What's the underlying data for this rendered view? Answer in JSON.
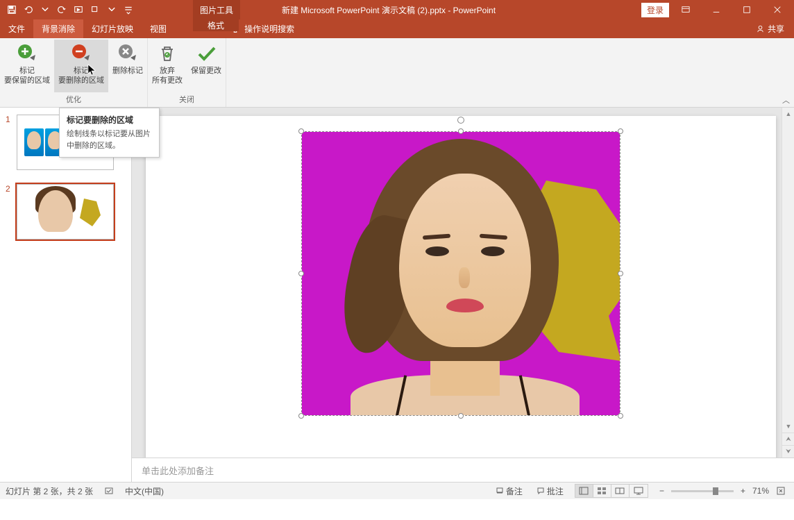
{
  "title": "新建 Microsoft PowerPoint 演示文稿 (2).pptx  -  PowerPoint",
  "tool_context": "图片工具",
  "login": "登录",
  "tabs": {
    "file": "文件",
    "bgremove": "背景消除",
    "slideshow": "幻灯片放映",
    "view": "视图",
    "format": "格式",
    "tell": "操作说明搜索",
    "share": "共享"
  },
  "ribbon": {
    "mark_keep": {
      "l1": "标记",
      "l2": "要保留的区域"
    },
    "mark_remove": {
      "l1": "标记",
      "l2": "要删除的区域"
    },
    "delete_marks": "删除标记",
    "group_refine": "优化",
    "discard": {
      "l1": "放弃",
      "l2": "所有更改"
    },
    "keep": "保留更改",
    "group_close": "关闭"
  },
  "tooltip": {
    "title": "标记要删除的区域",
    "body": "绘制线条以标记要从图片中删除的区域。"
  },
  "thumbs": {
    "n1": "1",
    "n2": "2"
  },
  "notes_placeholder": "单击此处添加备注",
  "status": {
    "slide_info": "幻灯片 第 2 张，共 2 张",
    "lang": "中文(中国)",
    "notes": "备注",
    "comments": "批注",
    "zoom_pct": "71%"
  }
}
